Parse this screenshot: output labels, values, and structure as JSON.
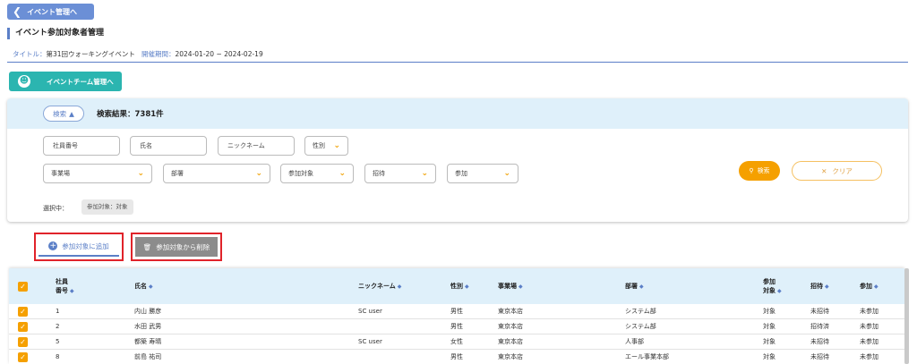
{
  "nav": {
    "back_label": "イベント管理へ"
  },
  "page": {
    "title": "イベント参加対象者管理"
  },
  "info": {
    "title_label": "タイトル：",
    "title_value": "第31回ウォーキングイベント",
    "period_label": "開催期間：",
    "period_value": "2024-01-20 ~ 2024-02-19"
  },
  "team_button": {
    "label": "イベントチーム管理へ"
  },
  "search": {
    "toggle_label": "検索",
    "result_label": "検索結果：",
    "result_count": "7381件",
    "employee_no_placeholder": "社員番号",
    "name_placeholder": "氏名",
    "nickname_placeholder": "ニックネーム",
    "gender_label": "性別",
    "office_label": "事業場",
    "department_label": "部署",
    "participation_target_label": "参加対象",
    "invite_label": "招待",
    "participation_label": "参加",
    "search_button": "検索",
    "clear_button": "クリア",
    "selected_label": "選択中：",
    "selected_chip": "参加対象：対象"
  },
  "actions": {
    "add_label": "参加対象に追加",
    "remove_label": "参加対象から削除"
  },
  "table": {
    "headers": {
      "employee_no_1": "社員",
      "employee_no_2": "番号",
      "name": "氏名",
      "nickname": "ニックネーム",
      "gender": "性別",
      "office": "事業場",
      "department": "部署",
      "target_1": "参加",
      "target_2": "対象",
      "invite": "招待",
      "participation": "参加"
    },
    "rows": [
      {
        "no": "1",
        "name": "内山 勝彦",
        "nickname": "SC user",
        "gender": "男性",
        "office": "東京本店",
        "dept": "システム部",
        "target": "対象",
        "invite": "未招待",
        "participation": "未参加"
      },
      {
        "no": "2",
        "name": "水田 武男",
        "nickname": "",
        "gender": "男性",
        "office": "東京本店",
        "dept": "システム部",
        "target": "対象",
        "invite": "招待済",
        "participation": "未参加"
      },
      {
        "no": "5",
        "name": "都築 寿晴",
        "nickname": "SC user",
        "gender": "女性",
        "office": "東京本店",
        "dept": "人事部",
        "target": "対象",
        "invite": "未招待",
        "participation": "未参加"
      },
      {
        "no": "8",
        "name": "前島 祐司",
        "nickname": "",
        "gender": "男性",
        "office": "東京本店",
        "dept": "エール事業本部",
        "target": "対象",
        "invite": "未招待",
        "participation": "未参加"
      }
    ]
  }
}
